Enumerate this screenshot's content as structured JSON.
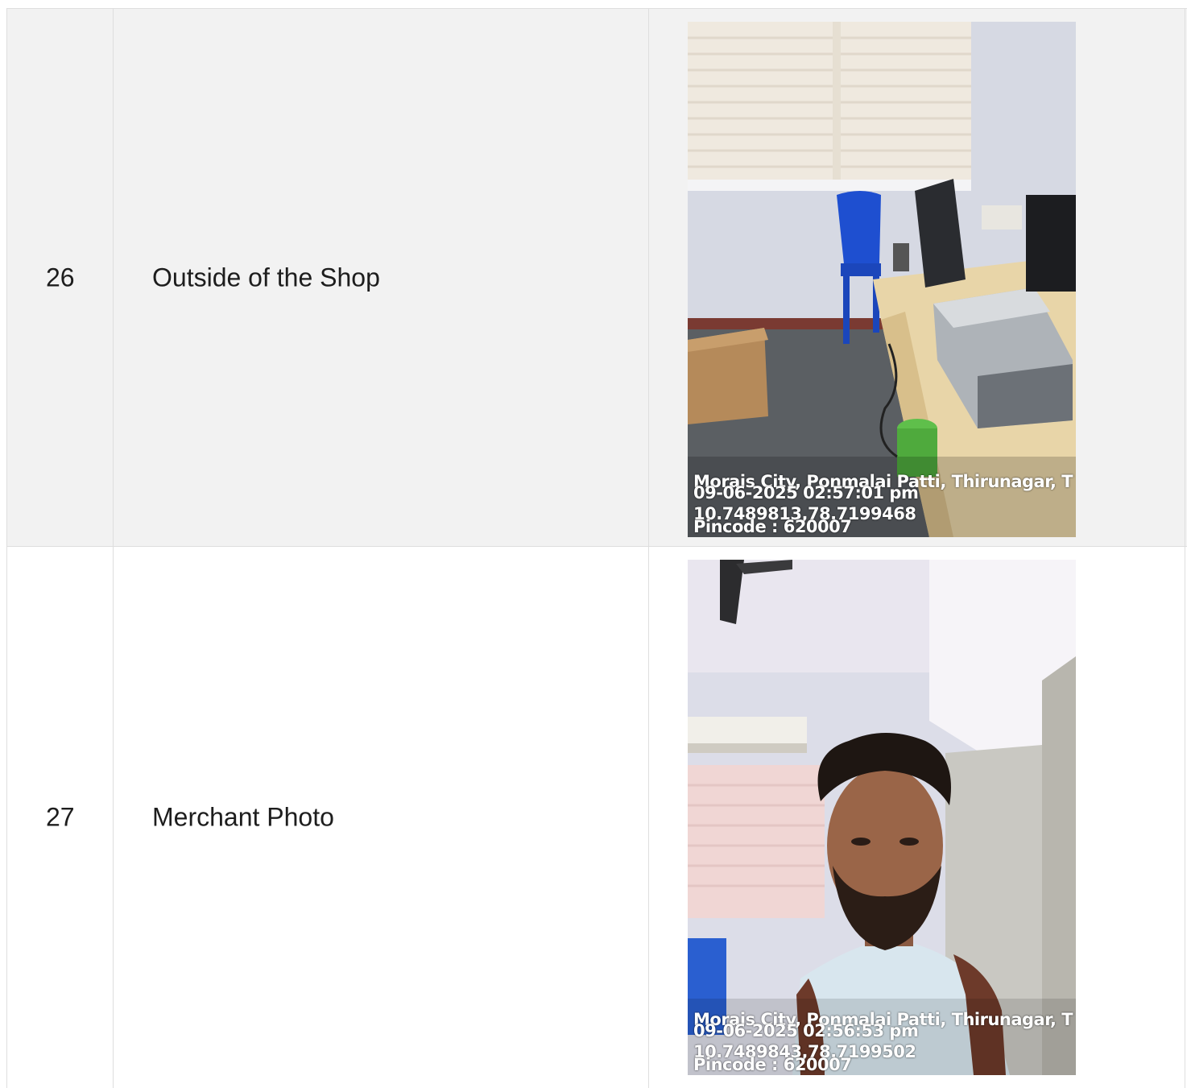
{
  "rows": [
    {
      "number": "26",
      "label": "Outside of the Shop",
      "photo": {
        "stamp_address": "Morais City, Ponmalai Patti, Thirunagar, T",
        "stamp_datetime": "09-06-2025 02:57:01 pm",
        "stamp_coords": "10.7489813,78.7199468",
        "stamp_pincode": "Pincode : 620007"
      }
    },
    {
      "number": "27",
      "label": "Merchant Photo",
      "photo": {
        "stamp_address": "Morais City, Ponmalai Patti, Thirunagar, T",
        "stamp_datetime": "09-06-2025 02:56:53 pm",
        "stamp_coords": "10.7489843,78.7199502",
        "stamp_pincode": "Pincode : 620007"
      }
    }
  ],
  "colors": {
    "shaded_row": "#f2f2f2",
    "border": "#dedede",
    "text": "#1d1d1d"
  }
}
